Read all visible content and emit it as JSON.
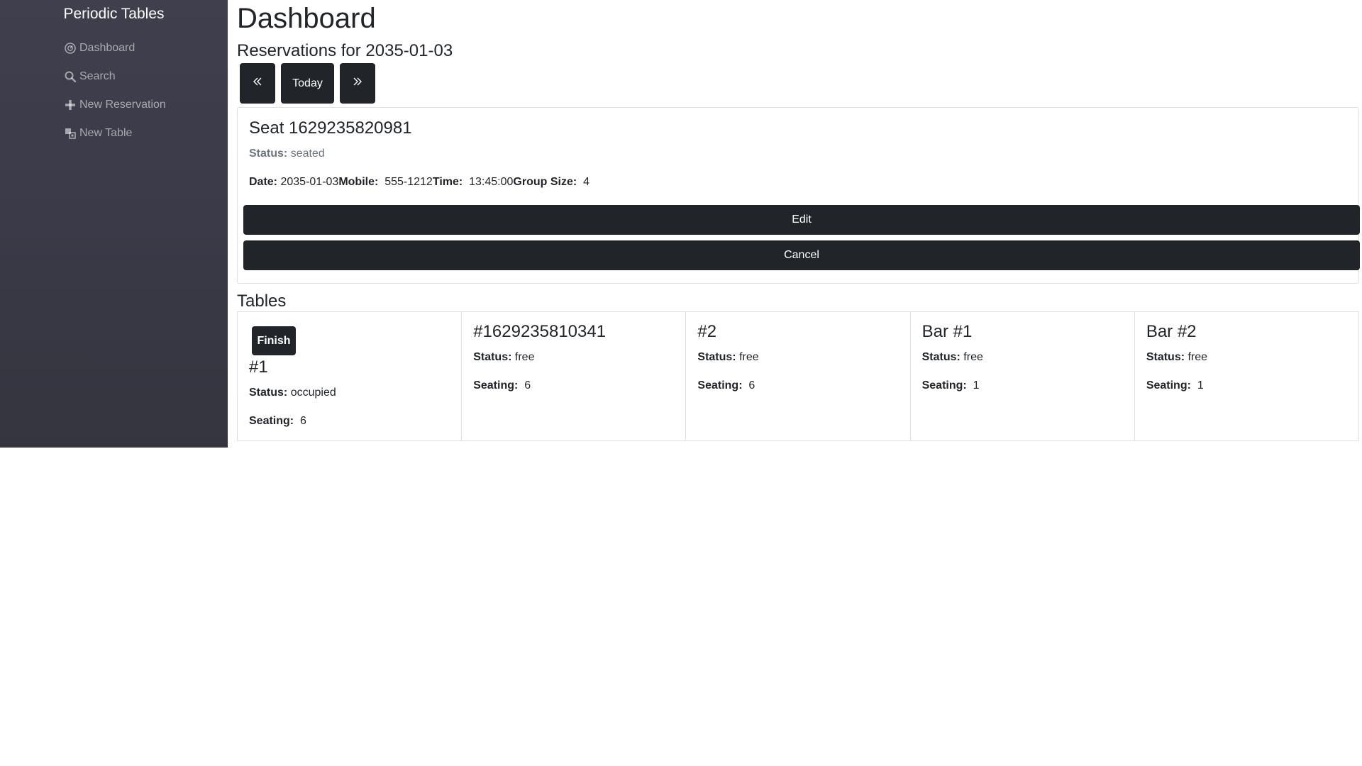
{
  "sidebar": {
    "brand": "Periodic Tables",
    "items": [
      {
        "label": "Dashboard",
        "icon": "dashboard-icon"
      },
      {
        "label": "Search",
        "icon": "search-icon"
      },
      {
        "label": "New Reservation",
        "icon": "plus-icon"
      },
      {
        "label": "New Table",
        "icon": "tables-icon"
      }
    ]
  },
  "main": {
    "title": "Dashboard",
    "subtitle": "Reservations for 2035-01-03",
    "date_nav": {
      "prev_icon": "double-chevron-left-icon",
      "today_label": "Today",
      "next_icon": "double-chevron-right-icon"
    },
    "reservation": {
      "title": "Seat 1629235820981",
      "status_label": "Status:",
      "status_value": "seated",
      "date_label": "Date:",
      "date_value": "2035-01-03",
      "mobile_label": "Mobile:",
      "mobile_value": "555-1212",
      "time_label": "Time:",
      "time_value": "13:45:00",
      "group_label": "Group Size:",
      "group_value": "4",
      "edit_label": "Edit",
      "cancel_label": "Cancel"
    },
    "tables_heading": "Tables",
    "tables": [
      {
        "name": "#1",
        "status_label": "Status:",
        "status": "occupied",
        "seating_label": "Seating:",
        "seating": "6",
        "finish_label": "Finish"
      },
      {
        "name": "#1629235810341",
        "status_label": "Status:",
        "status": "free",
        "seating_label": "Seating:",
        "seating": "6"
      },
      {
        "name": "#2",
        "status_label": "Status:",
        "status": "free",
        "seating_label": "Seating:",
        "seating": "6"
      },
      {
        "name": "Bar #1",
        "status_label": "Status:",
        "status": "free",
        "seating_label": "Seating:",
        "seating": "1"
      },
      {
        "name": "Bar #2",
        "status_label": "Status:",
        "status": "free",
        "seating_label": "Seating:",
        "seating": "1"
      }
    ]
  },
  "colors": {
    "sidebar_bg": "#3a3a48",
    "button_bg": "#212529",
    "muted_text": "#6c757d",
    "border": "#dee2e6"
  }
}
